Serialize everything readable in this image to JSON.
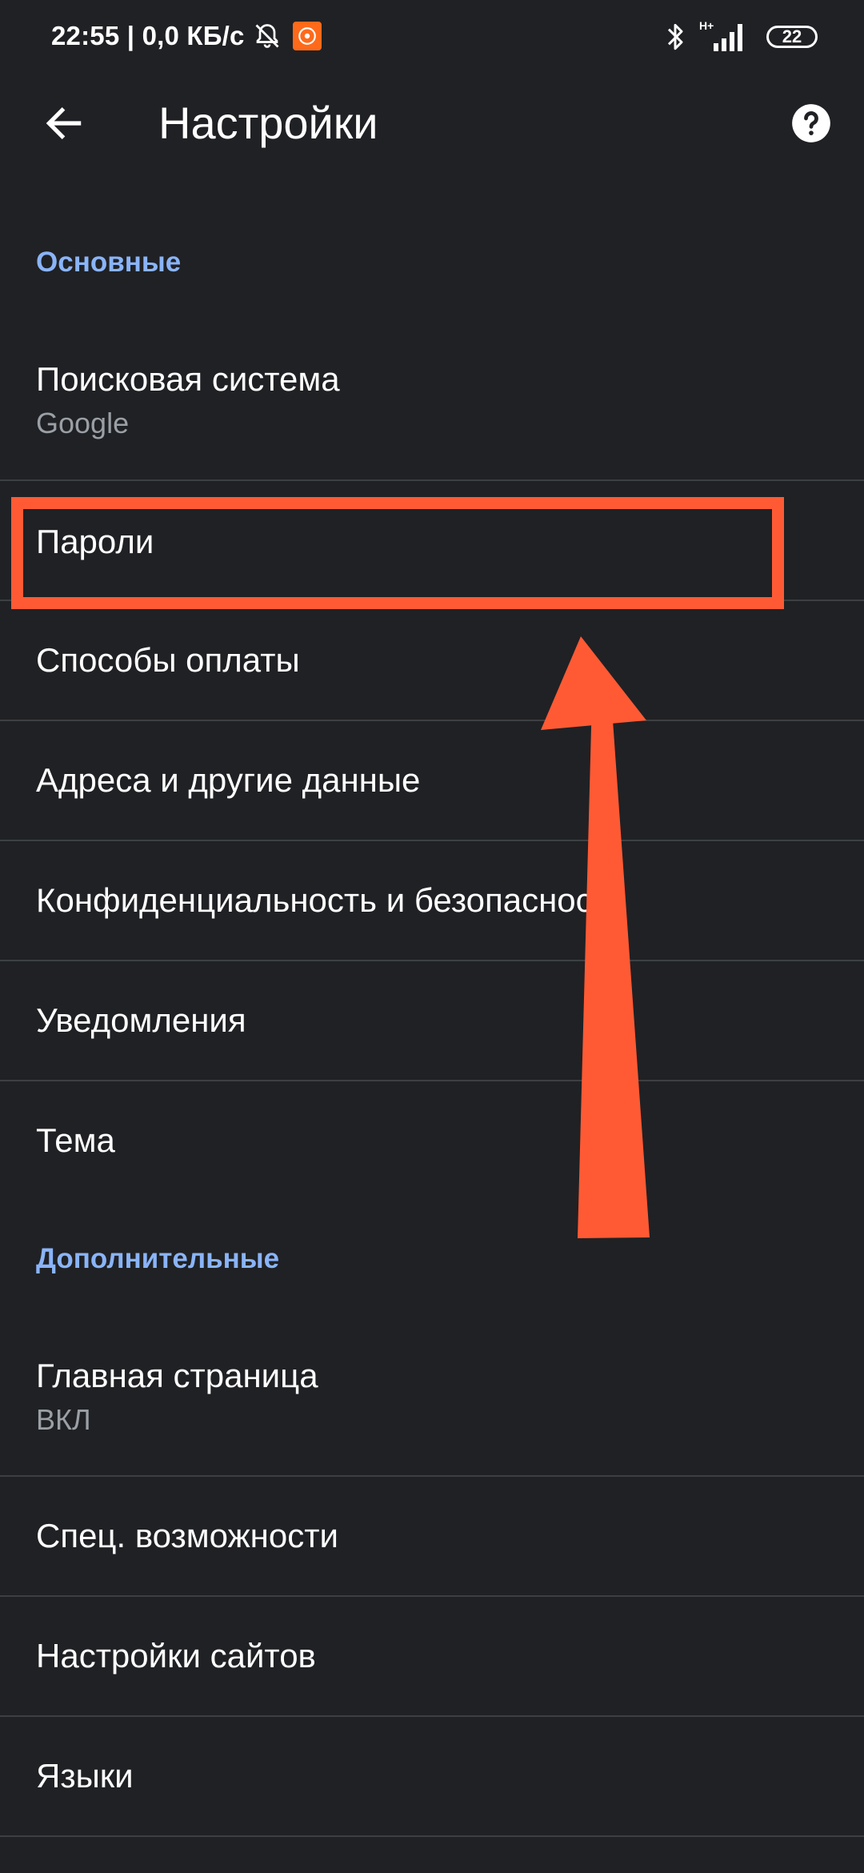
{
  "status_bar": {
    "time_and_speed": "22:55 | 0,0 КБ/с",
    "network_type": "H+",
    "battery_level": "22",
    "icons": [
      "bell-muted-icon",
      "mi-app-icon",
      "bluetooth-icon",
      "signal-icon",
      "battery-icon"
    ]
  },
  "app_bar": {
    "title": "Настройки",
    "back_icon": "arrow-left-icon",
    "help_icon": "help-circle-icon"
  },
  "sections": {
    "basic": {
      "header": "Основные",
      "items": [
        {
          "title": "Поисковая система",
          "subtitle": "Google"
        },
        {
          "title": "Пароли"
        },
        {
          "title": "Способы оплаты"
        },
        {
          "title": "Адреса и другие данные"
        },
        {
          "title": "Конфиденциальность и безопасность"
        },
        {
          "title": "Уведомления"
        },
        {
          "title": "Тема"
        }
      ]
    },
    "advanced": {
      "header": "Дополнительные",
      "items": [
        {
          "title": "Главная страница",
          "subtitle": "ВКЛ"
        },
        {
          "title": "Спец. возможности"
        },
        {
          "title": "Настройки сайтов"
        },
        {
          "title": "Языки"
        }
      ]
    }
  },
  "annotation": {
    "highlight_color": "#ff5a34",
    "highlighted_item": "Пароли"
  },
  "colors": {
    "background": "#202124",
    "accent": "#8ab4f8",
    "divider": "#3c4043"
  }
}
